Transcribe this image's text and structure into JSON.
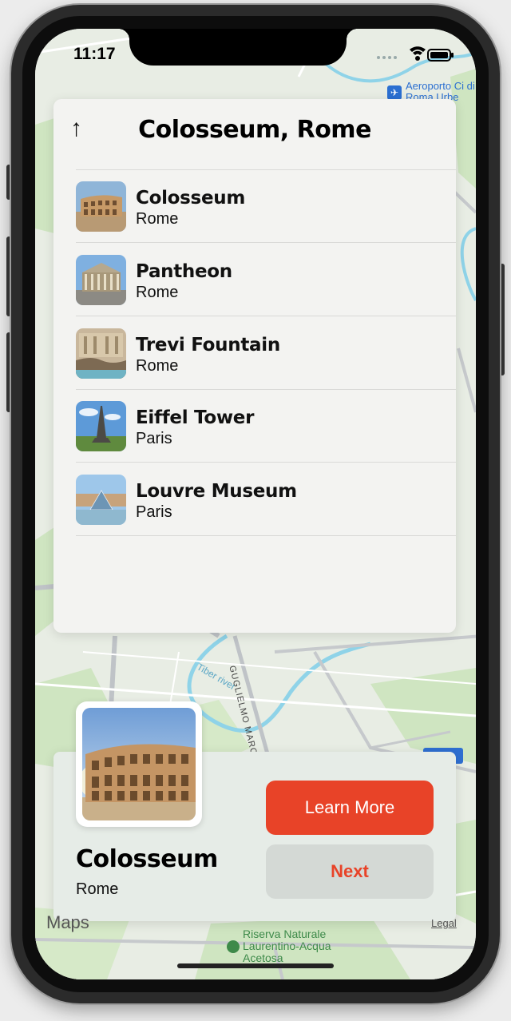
{
  "status_bar": {
    "time": "11:17"
  },
  "map": {
    "airport_label": "Aeroporto Ci di Roma Urbe",
    "river_label": "Tiber river",
    "street_label": "GUGLIELMO MARCONI",
    "park_label_line1": "Riserva Naturale",
    "park_label_line2": "Laurentino-Acqua",
    "park_label_line3": "Acetosa",
    "maps_logo": "Maps",
    "legal": "Legal"
  },
  "search_panel": {
    "title": "Colosseum, Rome",
    "back_icon": "arrow-up-icon",
    "items": [
      {
        "name": "Colosseum",
        "city": "Rome"
      },
      {
        "name": "Pantheon",
        "city": "Rome"
      },
      {
        "name": "Trevi Fountain",
        "city": "Rome"
      },
      {
        "name": "Eiffel Tower",
        "city": "Paris"
      },
      {
        "name": "Louvre Museum",
        "city": "Paris"
      }
    ]
  },
  "detail_card": {
    "title": "Colosseum",
    "subtitle": "Rome",
    "learn_more_label": "Learn More",
    "next_label": "Next"
  },
  "colors": {
    "accent": "#e84328",
    "panel_bg": "#f3f3f1",
    "card_bg": "#e6ece7",
    "next_bg": "#d4d9d5"
  }
}
